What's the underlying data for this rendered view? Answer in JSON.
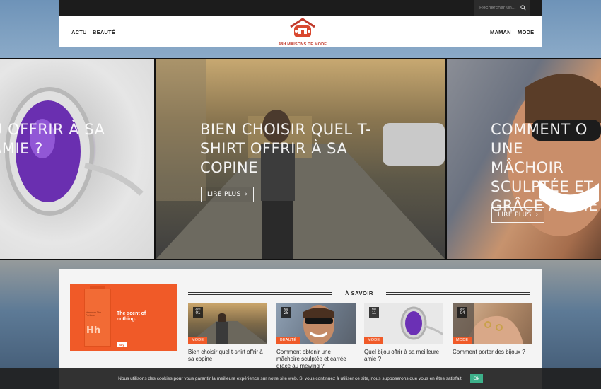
{
  "search": {
    "placeholder": "Rechercher un..."
  },
  "nav": {
    "left": [
      {
        "label": "ACTU"
      },
      {
        "label": "BEAUTÉ"
      }
    ],
    "right": [
      {
        "label": "MAMAN"
      },
      {
        "label": "MODE"
      }
    ]
  },
  "logo": {
    "text": "48H MAISONS DE MODE",
    "icon": "house-logo-icon"
  },
  "slider": {
    "slides": [
      {
        "title_lines": [
          "U OFFRIR À SA",
          "AMIE ?"
        ]
      },
      {
        "title_lines": [
          "BIEN CHOISIR QUEL T-",
          "SHIRT OFFRIR À SA",
          "COPINE"
        ],
        "button": "LIRE PLUS"
      },
      {
        "title_lines": [
          "COMMENT O",
          "UNE MÂCHOIR",
          "SCULPTÉE ET",
          "GRÂCE AU ME"
        ],
        "button": "LIRE PLUS"
      }
    ]
  },
  "ad": {
    "brand": "Hh",
    "tagline_1": "The scent of",
    "tagline_2": "nothing.",
    "buy": "Buy",
    "small_text": "Hominum The Perfume"
  },
  "section": {
    "title": "À SAVOIR"
  },
  "cards": [
    {
      "month": "AVR",
      "day": "01",
      "category": "MODE",
      "title": "Bien choisir quel t-shirt offrir à sa copine"
    },
    {
      "month": "MAI",
      "day": "25",
      "category": "BEAUTÉ",
      "title": "Comment obtenir une mâchoire sculptée et carrée grâce au mewing ?"
    },
    {
      "month": "MAI",
      "day": "11",
      "category": "MODE",
      "title": "Quel bijou offrir à sa meilleure amie ?"
    },
    {
      "month": "MER",
      "day": "04",
      "category": "MODE",
      "title": "Comment porter des bijoux ?"
    }
  ],
  "cookie": {
    "text": "Nous utilisons des cookies pour vous garantir la meilleure expérience sur notre site web. Si vous continuez à utiliser ce site, nous supposerons que vous en êtes satisfait.",
    "ok": "Ok"
  },
  "colors": {
    "accent": "#f05a28",
    "topbar": "#1c1c1c",
    "cookie_ok": "#3db08a"
  }
}
